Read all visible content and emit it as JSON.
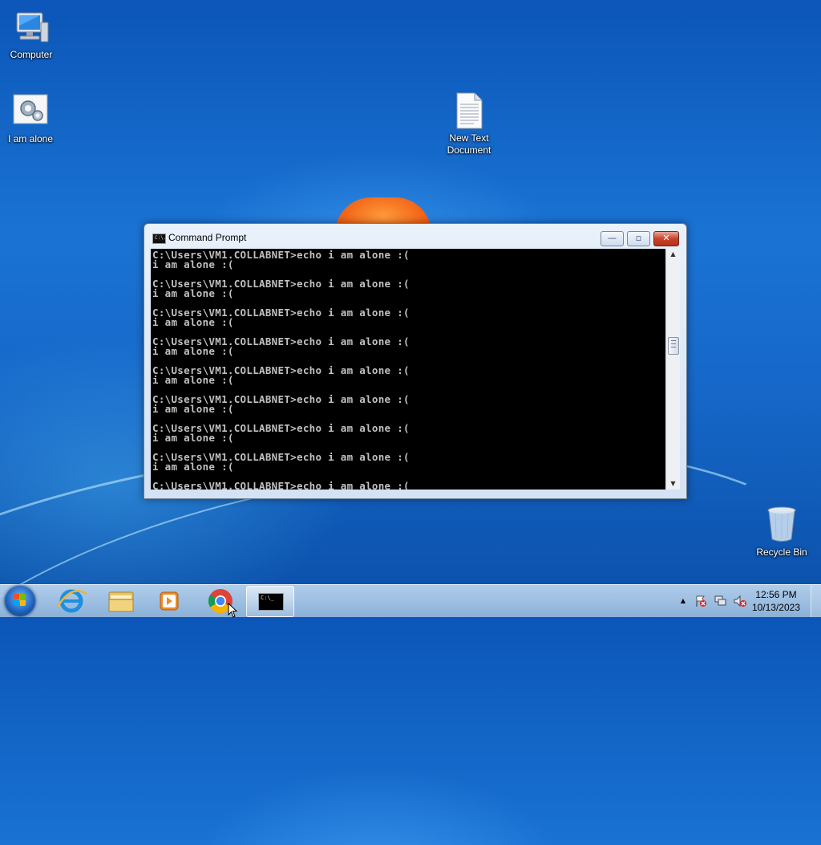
{
  "desktop": {
    "icons": [
      {
        "label": "Computer"
      },
      {
        "label": "I am alone"
      },
      {
        "label": "New Text Document"
      },
      {
        "label": "Recycle Bin"
      }
    ]
  },
  "window": {
    "title": "Command Prompt",
    "icon_text": "C:\\.",
    "minimize_symbol": "—",
    "maximize_symbol": "▫",
    "close_symbol": "✕",
    "console_lines": [
      "C:\\Users\\VM1.COLLABNET>echo i am alone :(",
      "i am alone :(",
      "",
      "C:\\Users\\VM1.COLLABNET>echo i am alone :(",
      "i am alone :(",
      "",
      "C:\\Users\\VM1.COLLABNET>echo i am alone :(",
      "i am alone :(",
      "",
      "C:\\Users\\VM1.COLLABNET>echo i am alone :(",
      "i am alone :(",
      "",
      "C:\\Users\\VM1.COLLABNET>echo i am alone :(",
      "i am alone :(",
      "",
      "C:\\Users\\VM1.COLLABNET>echo i am alone :(",
      "i am alone :(",
      "",
      "C:\\Users\\VM1.COLLABNET>echo i am alone :(",
      "i am alone :(",
      "",
      "C:\\Users\\VM1.COLLABNET>echo i am alone :(",
      "i am alone :(",
      "",
      "C:\\Users\\VM1.COLLABNET>echo i am alone :("
    ],
    "scroll_up_symbol": "▲",
    "scroll_down_symbol": "▼"
  },
  "taskbar": {
    "pinned": [
      "internet-explorer-icon",
      "file-explorer-icon",
      "media-player-icon",
      "chrome-icon",
      "command-prompt-icon"
    ],
    "active_app": "Command Prompt",
    "active_icon_text": "C:\\_",
    "tray_show_hidden_symbol": "▲",
    "clock_time": "12:56 PM",
    "clock_date": "10/13/2023"
  },
  "colors": {
    "desktop": "#1668c9",
    "console_bg": "#000000",
    "console_text": "#c0c0c0",
    "close_button": "#c8432a"
  }
}
